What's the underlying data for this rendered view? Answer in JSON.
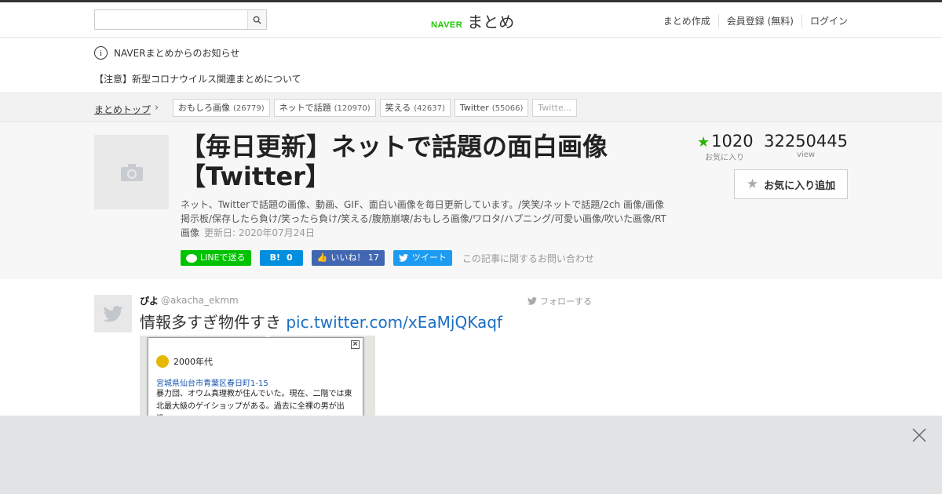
{
  "header": {
    "search_placeholder": "",
    "logo_brand": "NAVER",
    "logo_text": "まとめ",
    "nav": [
      "まとめ作成",
      "会員登録 (無料)",
      "ログイン"
    ]
  },
  "notice": {
    "heading": "NAVERまとめからのお知らせ",
    "item": "【注意】新型コロナウイルス関連まとめについて"
  },
  "breadcrumb": {
    "top": "まとめトップ",
    "tags": [
      {
        "label": "おもしろ画像",
        "count": "(26779)"
      },
      {
        "label": "ネットで話題",
        "count": "(120970)"
      },
      {
        "label": "笑える",
        "count": "(42637)"
      },
      {
        "label": "Twitter",
        "count": "(55066)"
      },
      {
        "label": "Twitte...",
        "count": ""
      }
    ]
  },
  "article": {
    "title": "【毎日更新】ネットで話題の面白画像【Twitter】",
    "description": "ネット、Twitterで話題の画像、動画、GIF、面白い画像を毎日更新しています。/笑笑/ネットで話題/2ch 画像/画像掲示板/保存したら負け/笑ったら負け/笑える/腹筋崩壊/おもしろ画像/ワロタ/ハプニング/可愛い画像/吹いた画像/RT画像",
    "updated": "更新日: 2020年07月24日",
    "favorites": "1020",
    "favorites_label": "お気に入り",
    "views": "32250445",
    "views_label": "view",
    "fav_button": "お気に入り追加",
    "share": {
      "line": "LINEで送る",
      "hatena": "0",
      "facebook": "いいね！ 17",
      "twitter": "ツイート"
    },
    "inquiry": "この記事に関するお問い合わせ"
  },
  "tweet": {
    "name": "ぴよ",
    "handle": "@akacha_ekmm",
    "follow": "フォローする",
    "text": "情報多すぎ物件すき",
    "link": "pic.twitter.com/xEaMjQKaqf",
    "image": {
      "era": "2000年代",
      "address": "宮城県仙台市青葉区春日町1-15",
      "body": "暴力団、オウム真理教が住んでいた。現在、二階では東北最大級のゲイショップがある。過去に全裸の男が出没。"
    }
  },
  "colors": {
    "naver_green": "#1ec800",
    "star_green": "#2db400",
    "line": "#00c300",
    "hatena": "#008fde",
    "facebook": "#4267b2",
    "twitter": "#1d9bf0",
    "link": "#1a6fc4"
  }
}
